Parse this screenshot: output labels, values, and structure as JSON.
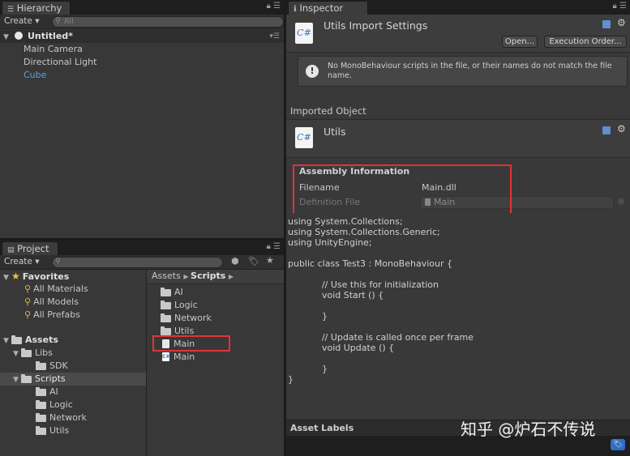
{
  "hierarchy": {
    "tab_label": "Hierarchy",
    "create_label": "Create ▾",
    "search_placeholder": "All",
    "scene_name": "Untitled*",
    "items": [
      "Main Camera",
      "Directional Light",
      "Cube"
    ]
  },
  "project": {
    "tab_label": "Project",
    "create_label": "Create ▾",
    "favorites_label": "Favorites",
    "favorites": [
      "All Materials",
      "All Models",
      "All Prefabs"
    ],
    "assets_label": "Assets",
    "libs_label": "Libs",
    "sdk_label": "SDK",
    "scripts_label": "Scripts",
    "scripts_children": [
      "AI",
      "Logic",
      "Network",
      "Utils"
    ],
    "breadcrumb_root": "Assets",
    "breadcrumb_current": "Scripts",
    "folder_items": [
      "AI",
      "Logic",
      "Network",
      "Utils"
    ],
    "file_items": [
      "Main",
      "Main"
    ]
  },
  "inspector": {
    "tab_label": "Inspector",
    "title": "Utils Import Settings",
    "open_label": "Open...",
    "exec_order_label": "Execution Order...",
    "info_message": "No MonoBehaviour scripts in the file, or their names do not match the file name.",
    "imported_object_label": "Imported Object",
    "object_name": "Utils",
    "assembly_header": "Assembly Information",
    "filename_label": "Filename",
    "filename_value": "Main.dll",
    "definition_label": "Definition File",
    "definition_value": "Main",
    "code_lines": [
      "using System.Collections;",
      "using System.Collections.Generic;",
      "using UnityEngine;",
      "",
      "public class Test3 : MonoBehaviour {",
      "",
      "            // Use this for initialization",
      "            void Start () {",
      "",
      "            }",
      "",
      "            // Update is called once per frame",
      "            void Update () {",
      "",
      "            }",
      "}"
    ],
    "asset_labels": "Asset Labels",
    "watermark": "知乎 @炉石不传说"
  },
  "colors": {
    "highlight_red": "#e0343b",
    "cube_blue": "#5aa0e6",
    "selection": "#4a4a4a"
  }
}
